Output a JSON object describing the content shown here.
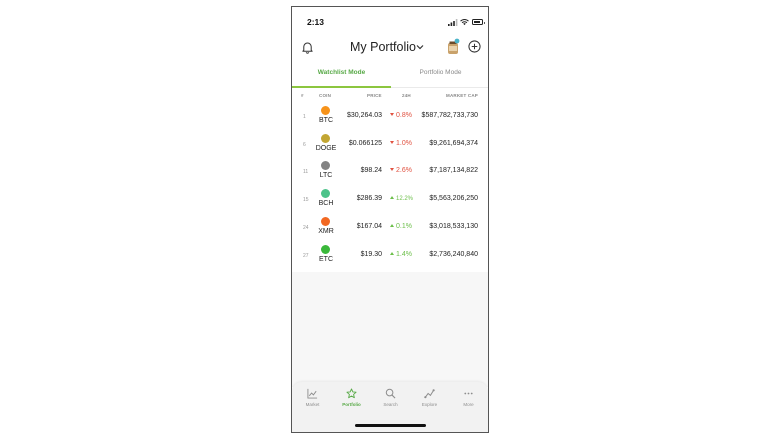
{
  "status_bar": {
    "time": "2:13"
  },
  "header": {
    "title": "My Portfolio"
  },
  "tabs": [
    {
      "label": "Watchlist Mode",
      "active": true
    },
    {
      "label": "Portfolio Mode",
      "active": false
    }
  ],
  "table": {
    "headers": {
      "rank": "#",
      "coin": "COIN",
      "price": "PRICE",
      "change": "24H",
      "market_cap": "MARKET CAP"
    },
    "rows": [
      {
        "rank": "1",
        "coin": "BTC",
        "price": "$30,264.03",
        "change": "0.8%",
        "direction": "down",
        "market_cap": "$587,782,733,730",
        "icon_color": "#f7931a"
      },
      {
        "rank": "6",
        "coin": "DOGE",
        "price": "$0.066125",
        "change": "1.0%",
        "direction": "down",
        "market_cap": "$9,261,694,374",
        "icon_color": "#c2a633"
      },
      {
        "rank": "11",
        "coin": "LTC",
        "price": "$98.24",
        "change": "2.6%",
        "direction": "down",
        "market_cap": "$7,187,134,822",
        "icon_color": "#838383"
      },
      {
        "rank": "15",
        "coin": "BCH",
        "price": "$286.39",
        "change": "12.2%",
        "direction": "up",
        "market_cap": "$5,563,206,250",
        "icon_color": "#4cc38a"
      },
      {
        "rank": "24",
        "coin": "XMR",
        "price": "$167.04",
        "change": "0.1%",
        "direction": "up",
        "market_cap": "$3,018,533,130",
        "icon_color": "#f26822"
      },
      {
        "rank": "27",
        "coin": "ETC",
        "price": "$19.30",
        "change": "1.4%",
        "direction": "up",
        "market_cap": "$2,736,240,840",
        "icon_color": "#3ab83a"
      }
    ]
  },
  "tab_bar": [
    {
      "label": "Market",
      "icon": "chart-icon",
      "active": false
    },
    {
      "label": "Portfolio",
      "icon": "star-icon",
      "active": true
    },
    {
      "label": "Search",
      "icon": "search-icon",
      "active": false
    },
    {
      "label": "Explore",
      "icon": "explore-icon",
      "active": false
    },
    {
      "label": "More",
      "icon": "more-icon",
      "active": false
    }
  ],
  "colors": {
    "accent": "#8cc63f",
    "up": "#6cbf4a",
    "down": "#e15241"
  }
}
